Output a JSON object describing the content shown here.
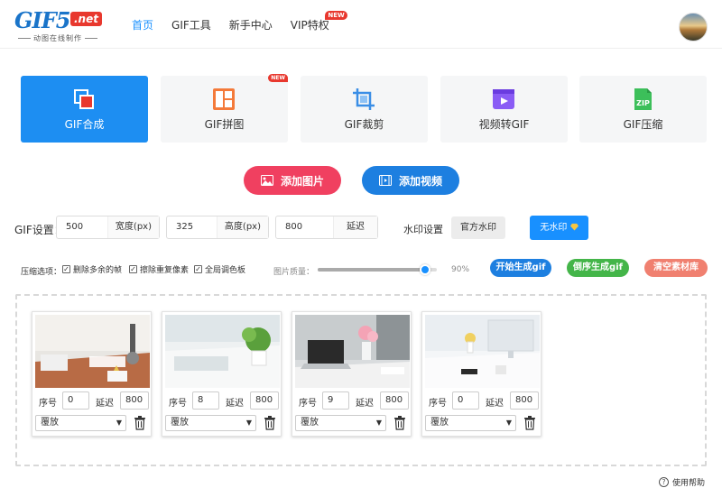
{
  "logo": {
    "main": "GIF5",
    "net": ".net",
    "sub": "动图在线制作"
  },
  "nav": [
    {
      "label": "首页",
      "active": true
    },
    {
      "label": "GIF工具"
    },
    {
      "label": "新手中心"
    },
    {
      "label": "VIP特权",
      "badge": "NEW"
    }
  ],
  "tools": [
    {
      "label": "GIF合成",
      "icon": "merge-icon",
      "active": true
    },
    {
      "label": "GIF拼图",
      "icon": "collage-icon",
      "badge": "NEW"
    },
    {
      "label": "GIF裁剪",
      "icon": "crop-icon"
    },
    {
      "label": "视频转GIF",
      "icon": "video-icon"
    },
    {
      "label": "GIF压缩",
      "icon": "zip-icon",
      "zip_text": "ZIP"
    }
  ],
  "buttons": {
    "add_image": "添加图片",
    "add_video": "添加视频"
  },
  "settings": {
    "label": "GIF设置：",
    "width_value": "500",
    "width_unit": "宽度(px)",
    "height_value": "325",
    "height_unit": "高度(px)",
    "delay_value": "800",
    "delay_unit": "延迟",
    "watermark_label": "水印设置",
    "watermark_official": "官方水印",
    "watermark_none": "无水印"
  },
  "compression": {
    "label": "压缩选项：",
    "options": [
      "删除多余的帧",
      "擦除重复像素",
      "全局调色板"
    ],
    "quality_label": "图片质量：",
    "quality_value": "90%",
    "quality_fraction": 0.9
  },
  "actions": {
    "start": "开始生成gif",
    "reverse": "倒序生成gif",
    "clear": "清空素材库"
  },
  "frames": [
    {
      "order_label": "序号",
      "order": "0",
      "delay_label": "延迟",
      "delay": "800",
      "mode": "覆放"
    },
    {
      "order_label": "序号",
      "order": "8",
      "delay_label": "延迟",
      "delay": "800",
      "mode": "覆放"
    },
    {
      "order_label": "序号",
      "order": "9",
      "delay_label": "延迟",
      "delay": "800",
      "mode": "覆放"
    },
    {
      "order_label": "序号",
      "order": "0",
      "delay_label": "延迟",
      "delay": "800",
      "mode": "覆放"
    }
  ],
  "help": "使用帮助",
  "colors": {
    "primary": "#1890ff",
    "pink": "#f04060",
    "green": "#44b549",
    "salmon": "#f08070",
    "red_badge": "#e8382e"
  }
}
